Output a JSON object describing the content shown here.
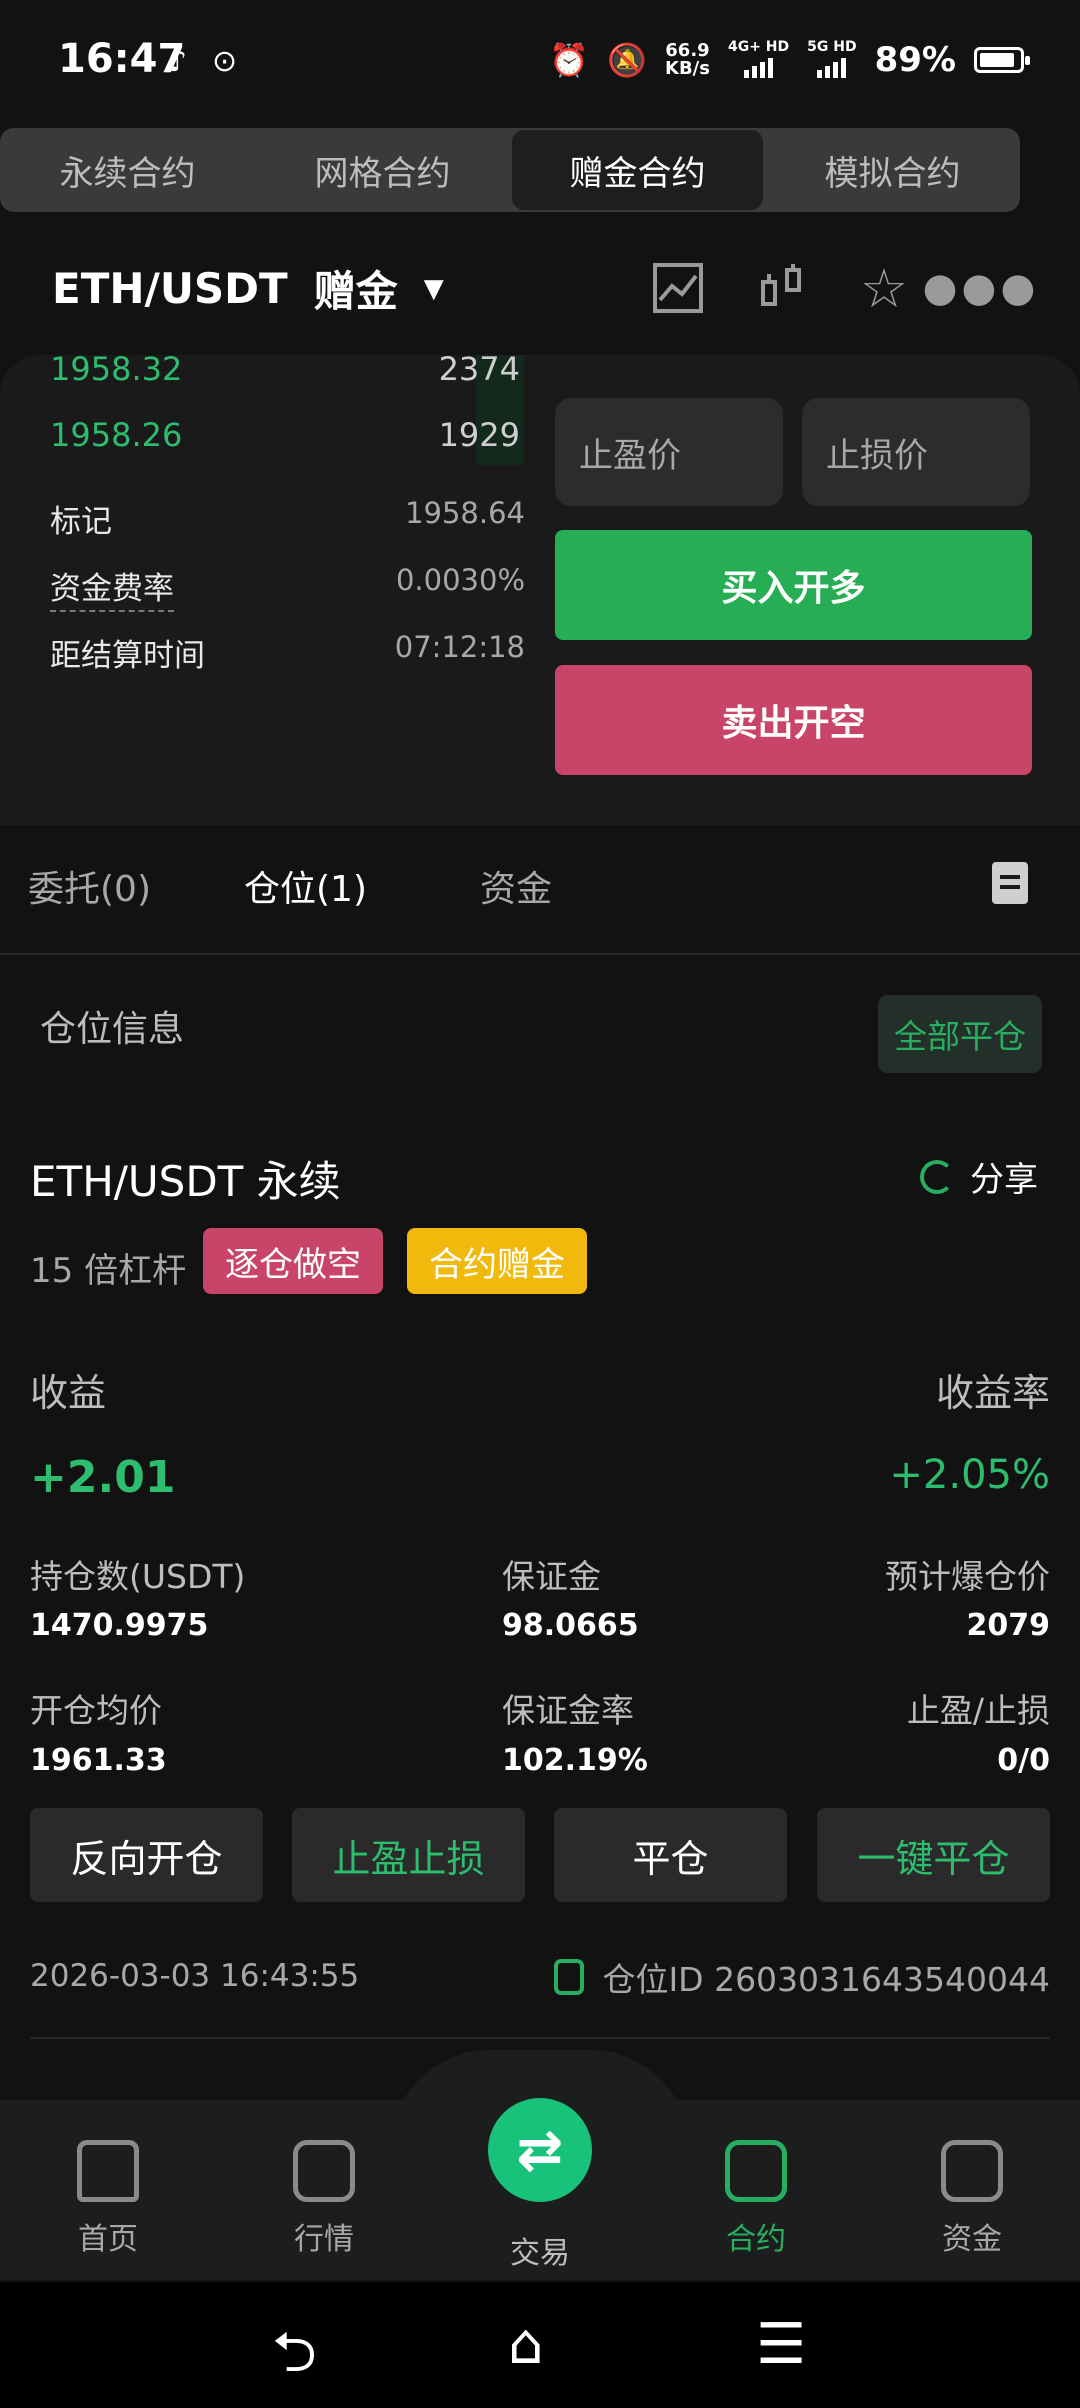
{
  "status_bar": {
    "time": "16:47",
    "net_speed_top": "66.9",
    "net_speed_bottom": "KB/s",
    "net_type_1": "4G+ HD",
    "net_type_2": "5G HD",
    "battery": "89%",
    "battery_level": 0.89
  },
  "contract_tabs": [
    "永续合约",
    "网格合约",
    "赠金合约",
    "模拟合约"
  ],
  "contract_tabs_active": 2,
  "pair": {
    "symbol": "ETH/USDT",
    "mode": "赠金"
  },
  "orderbook": [
    {
      "price": "1958.32",
      "qty": "2374"
    },
    {
      "price": "1958.26",
      "qty": "1929"
    }
  ],
  "market_info": [
    {
      "label": "标记",
      "value": "1958.64"
    },
    {
      "label": "资金费率",
      "value": "0.0030%"
    },
    {
      "label": "距结算时间",
      "value": "07:12:18"
    }
  ],
  "order_form": {
    "take_profit_placeholder": "止盈价",
    "stop_loss_placeholder": "止损价",
    "buy_label": "买入开多",
    "sell_label": "卖出开空"
  },
  "position_tabs": [
    "委托(0)",
    "仓位(1)",
    "资金"
  ],
  "position_tabs_active": 1,
  "position_section": {
    "title": "仓位信息",
    "close_all": "全部平仓"
  },
  "position": {
    "pair": "ETH/USDT 永续",
    "share": "分享",
    "leverage": "15 倍杠杆",
    "tag_short": "逐仓做空",
    "tag_bonus": "合约赠金",
    "pnl_label": "收益",
    "roi_label": "收益率",
    "pnl": "+2.01",
    "roi": "+2.05%",
    "stats": [
      {
        "label": "持仓数(USDT)",
        "value": "1470.9975"
      },
      {
        "label": "保证金",
        "value": "98.0665"
      },
      {
        "label": "预计爆仓价",
        "value": "2079"
      },
      {
        "label": "开仓均价",
        "value": "1961.33"
      },
      {
        "label": "保证金率",
        "value": "102.19%"
      },
      {
        "label": "止盈/止损",
        "value": "0/0"
      }
    ],
    "actions": [
      "反向开仓",
      "止盈止损",
      "平仓",
      "一键平仓"
    ],
    "time": "2026-03-03 16:43:55",
    "position_id": "仓位ID 2603031643540044"
  },
  "bottom_nav": {
    "items": [
      "首页",
      "行情",
      "交易",
      "合约",
      "资金"
    ],
    "active": 3
  },
  "colors": {
    "green": "#2dbd6e",
    "red": "#c84468",
    "yellow": "#f0b90b",
    "background": "#121212"
  }
}
